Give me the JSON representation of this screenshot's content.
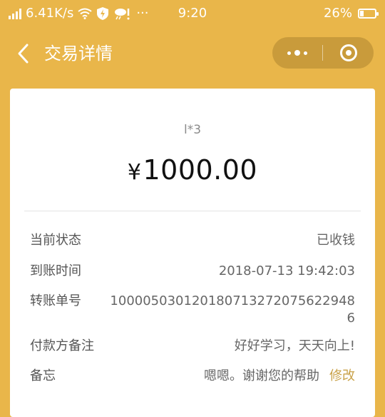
{
  "status_bar": {
    "net_speed": "6.41K/s",
    "time": "9:20",
    "battery": "26%",
    "battery_level": 0.26,
    "icons": [
      "signal-icon",
      "wifi-icon",
      "shield-icon",
      "weather-icon",
      "more-dots-icon"
    ],
    "dots": "···"
  },
  "nav": {
    "title": "交易详情",
    "back_icon": "chevron-left-icon",
    "more_icon": "more-dots-icon",
    "close_icon": "target-close-icon"
  },
  "transaction": {
    "payee": "l*3",
    "currency_symbol": "¥",
    "amount": "1000.00"
  },
  "details": {
    "status_label": "当前状态",
    "status_value": "已收钱",
    "time_label": "到账时间",
    "time_value": "2018-07-13 19:42:03",
    "order_label": "转账单号",
    "order_value": "10000503012018071327207562294​86",
    "payer_note_label": "付款方备注",
    "payer_note_value": "好好学习，天天向上!",
    "memo_label": "备忘",
    "memo_value": "嗯嗯。谢谢您的帮助",
    "edit_label": "修改"
  },
  "colors": {
    "background": "#e9b64a",
    "accent": "#c9a24a"
  }
}
